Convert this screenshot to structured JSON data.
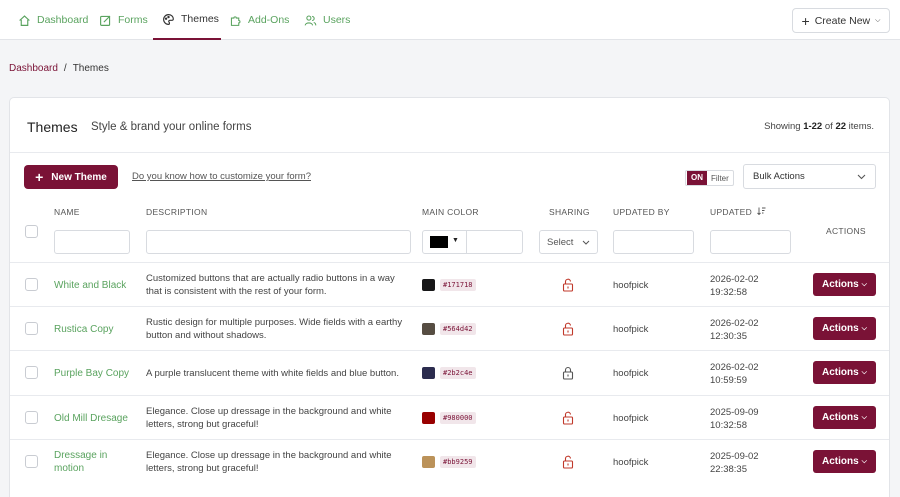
{
  "nav": {
    "items": [
      {
        "label": "Dashboard",
        "icon": "home-icon"
      },
      {
        "label": "Forms",
        "icon": "edit-icon"
      },
      {
        "label": "Themes",
        "icon": "palette-icon"
      },
      {
        "label": "Add-Ons",
        "icon": "puzzle-icon"
      },
      {
        "label": "Users",
        "icon": "users-icon"
      }
    ],
    "active": "Themes",
    "create_new": "Create New"
  },
  "breadcrumb": {
    "parent": "Dashboard",
    "separator": "/",
    "current": "Themes"
  },
  "header": {
    "title": "Themes",
    "subtitle": "Style & brand your online forms",
    "showing_prefix": "Showing",
    "showing_range": "1-22",
    "showing_of": "of",
    "showing_total": "22",
    "showing_suffix": "items."
  },
  "toolbar": {
    "new_theme": "New Theme",
    "help_link": "Do you know how to customize your form?",
    "filter_on": "ON",
    "filter_label": "Filter",
    "bulk_actions": "Bulk Actions"
  },
  "columns": {
    "name": "NAME",
    "description": "DESCRIPTION",
    "main_color": "MAIN COLOR",
    "sharing": "SHARING",
    "updated_by": "UPDATED BY",
    "updated": "UPDATED",
    "actions": "ACTIONS"
  },
  "filters": {
    "color": "#000000",
    "sharing": "Select"
  },
  "rows": [
    {
      "name": "White and Black",
      "description": "Customized buttons that are actually radio buttons in a way that is consistent with the rest of your form.",
      "color": "#171718",
      "sharing": "unlocked",
      "updated_by": "hoofpick",
      "date": "2026-02-02",
      "time": "19:32:58",
      "actions": "Actions"
    },
    {
      "name": "Rustica Copy",
      "description": "Rustic design for multiple purposes. Wide fields with a earthy button and without shadows.",
      "color": "#564d42",
      "sharing": "unlocked",
      "updated_by": "hoofpick",
      "date": "2026-02-02",
      "time": "12:30:35",
      "actions": "Actions"
    },
    {
      "name": "Purple Bay Copy",
      "description": "A purple translucent theme with white fields and blue button.",
      "color": "#2b2c4e",
      "sharing": "locked",
      "updated_by": "hoofpick",
      "date": "2026-02-02",
      "time": "10:59:59",
      "actions": "Actions"
    },
    {
      "name": "Old Mill Dresage",
      "description": "Elegance. Close up dressage in the background and white letters, strong but graceful!",
      "color": "#980000",
      "sharing": "unlocked",
      "updated_by": "hoofpick",
      "date": "2025-09-09",
      "time": "10:32:58",
      "actions": "Actions"
    },
    {
      "name": "Dressage in motion",
      "description": "Elegance. Close up dressage in the background and white letters, strong but graceful!",
      "color": "#bb9259",
      "sharing": "unlocked",
      "updated_by": "hoofpick",
      "date": "2025-09-02",
      "time": "22:38:35",
      "actions": "Actions"
    }
  ],
  "colors": {
    "brand": "#7a1236",
    "link": "#5aa35f",
    "unlocked": "#c0392b",
    "locked": "#555555"
  }
}
